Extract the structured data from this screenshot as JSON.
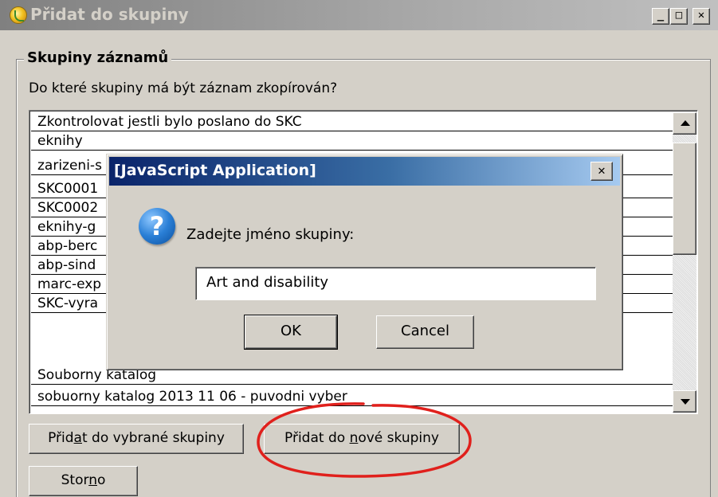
{
  "window": {
    "title": "Přidat do skupiny",
    "controls": {
      "minimize": "_",
      "maximize": "□",
      "close": "✕"
    }
  },
  "group": {
    "legend": "Skupiny záznamů",
    "question": "Do které skupiny má být záznam zkopírován?"
  },
  "list": {
    "items": [
      "Zkontrolovat jestli bylo poslano do SKC",
      "eknihy",
      "zarizeni-s",
      "SKC0001",
      "SKC0002",
      "eknihy-g",
      "abp-berc",
      "abp-sind",
      "marc-exp",
      "SKC-vyra",
      "Souborny katalog",
      "sobuorny katalog 2013 11 06 - puvodni vyber"
    ]
  },
  "buttons": {
    "add_selected": {
      "pre": "Přid",
      "key": "a",
      "post": "t do vybrané skupiny"
    },
    "add_new": {
      "pre": "Přidat do ",
      "key": "n",
      "post": "ové skupiny"
    },
    "cancel": {
      "pre": "Stor",
      "key": "n",
      "post": "o"
    }
  },
  "dialog": {
    "title": "[JavaScript Application]",
    "close": "✕",
    "icon": "?",
    "prompt": "Zadejte jméno skupiny:",
    "input_value": "Art and disability",
    "ok": "OK",
    "cancel": "Cancel"
  },
  "colors": {
    "window_bg": "#d4d0c8",
    "dialog_title_start": "#0a246a",
    "annotation": "#e0201c"
  }
}
